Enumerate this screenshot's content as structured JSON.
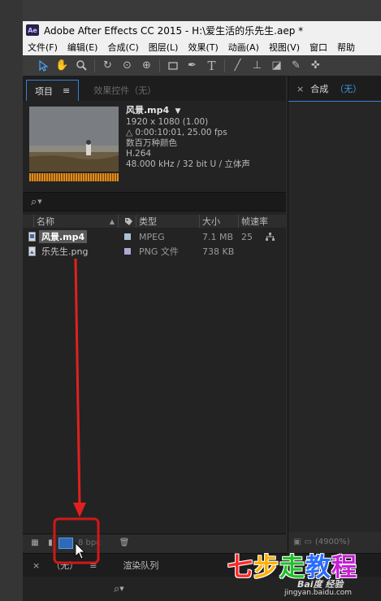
{
  "window": {
    "app_icon": "Ae",
    "title": "Adobe After Effects CC 2015 - H:\\爱生活的乐先生.aep *"
  },
  "menu": [
    "文件(F)",
    "编辑(E)",
    "合成(C)",
    "图层(L)",
    "效果(T)",
    "动画(A)",
    "视图(V)",
    "窗口",
    "帮助"
  ],
  "toolbar": {
    "icons": [
      "selection-arrow-icon",
      "hand-icon",
      "zoom-icon",
      "rotate-icon",
      "camera-orbit-icon",
      "pan-behind-icon",
      "rectangle-icon",
      "pen-icon",
      "text-icon",
      "brush-icon",
      "clone-stamp-icon",
      "eraser-icon",
      "roto-brush-icon",
      "puppet-pin-icon"
    ]
  },
  "project_panel": {
    "tab_project": "项目",
    "tab_menu_glyph": "≡",
    "tab_effects": "效果控件（无）",
    "selected_info": {
      "name": "风景.mp4",
      "resolution": "1920 x 1080 (1.00)",
      "duration": "△ 0:00:10:01, 25.00 fps",
      "colors": "数百万种颜色",
      "codec": "H.264",
      "audio": "48.000 kHz / 32 bit U / 立体声"
    },
    "search_glyph": "⌕",
    "columns": [
      "名称",
      "类型",
      "大小",
      "帧速率"
    ],
    "items": [
      {
        "name": "风景.mp4",
        "type": "MPEG",
        "size": "7.1 MB",
        "fps": "25",
        "label_color": "#a9c1d6",
        "selected": true
      },
      {
        "name": "乐先生.png",
        "type": "PNG 文件",
        "size": "738 KB",
        "fps": "",
        "label_color": "#b3a6d6",
        "selected": false
      }
    ],
    "bpc": "8 bpc"
  },
  "comp_panel": {
    "tab_label": "合成",
    "tab_value": "（无）",
    "zoom": "(4900%)"
  },
  "bottom_panel": {
    "tab_none": "（无）",
    "tab_render": "渲染队列"
  },
  "watermark": {
    "chars": [
      {
        "char": "七",
        "color": "#ff2a2a"
      },
      {
        "char": "步",
        "color": "#ffb000"
      },
      {
        "char": "走",
        "color": "#22c02a"
      },
      {
        "char": "教",
        "color": "#2a6cff"
      },
      {
        "char": "程",
        "color": "#c81ed6"
      }
    ],
    "baidu": "Bai度 经验",
    "url": "jingyan.baidu.com"
  },
  "annotation_colors": {
    "arrow": "#e02020",
    "highlight_box": "#d01818"
  }
}
